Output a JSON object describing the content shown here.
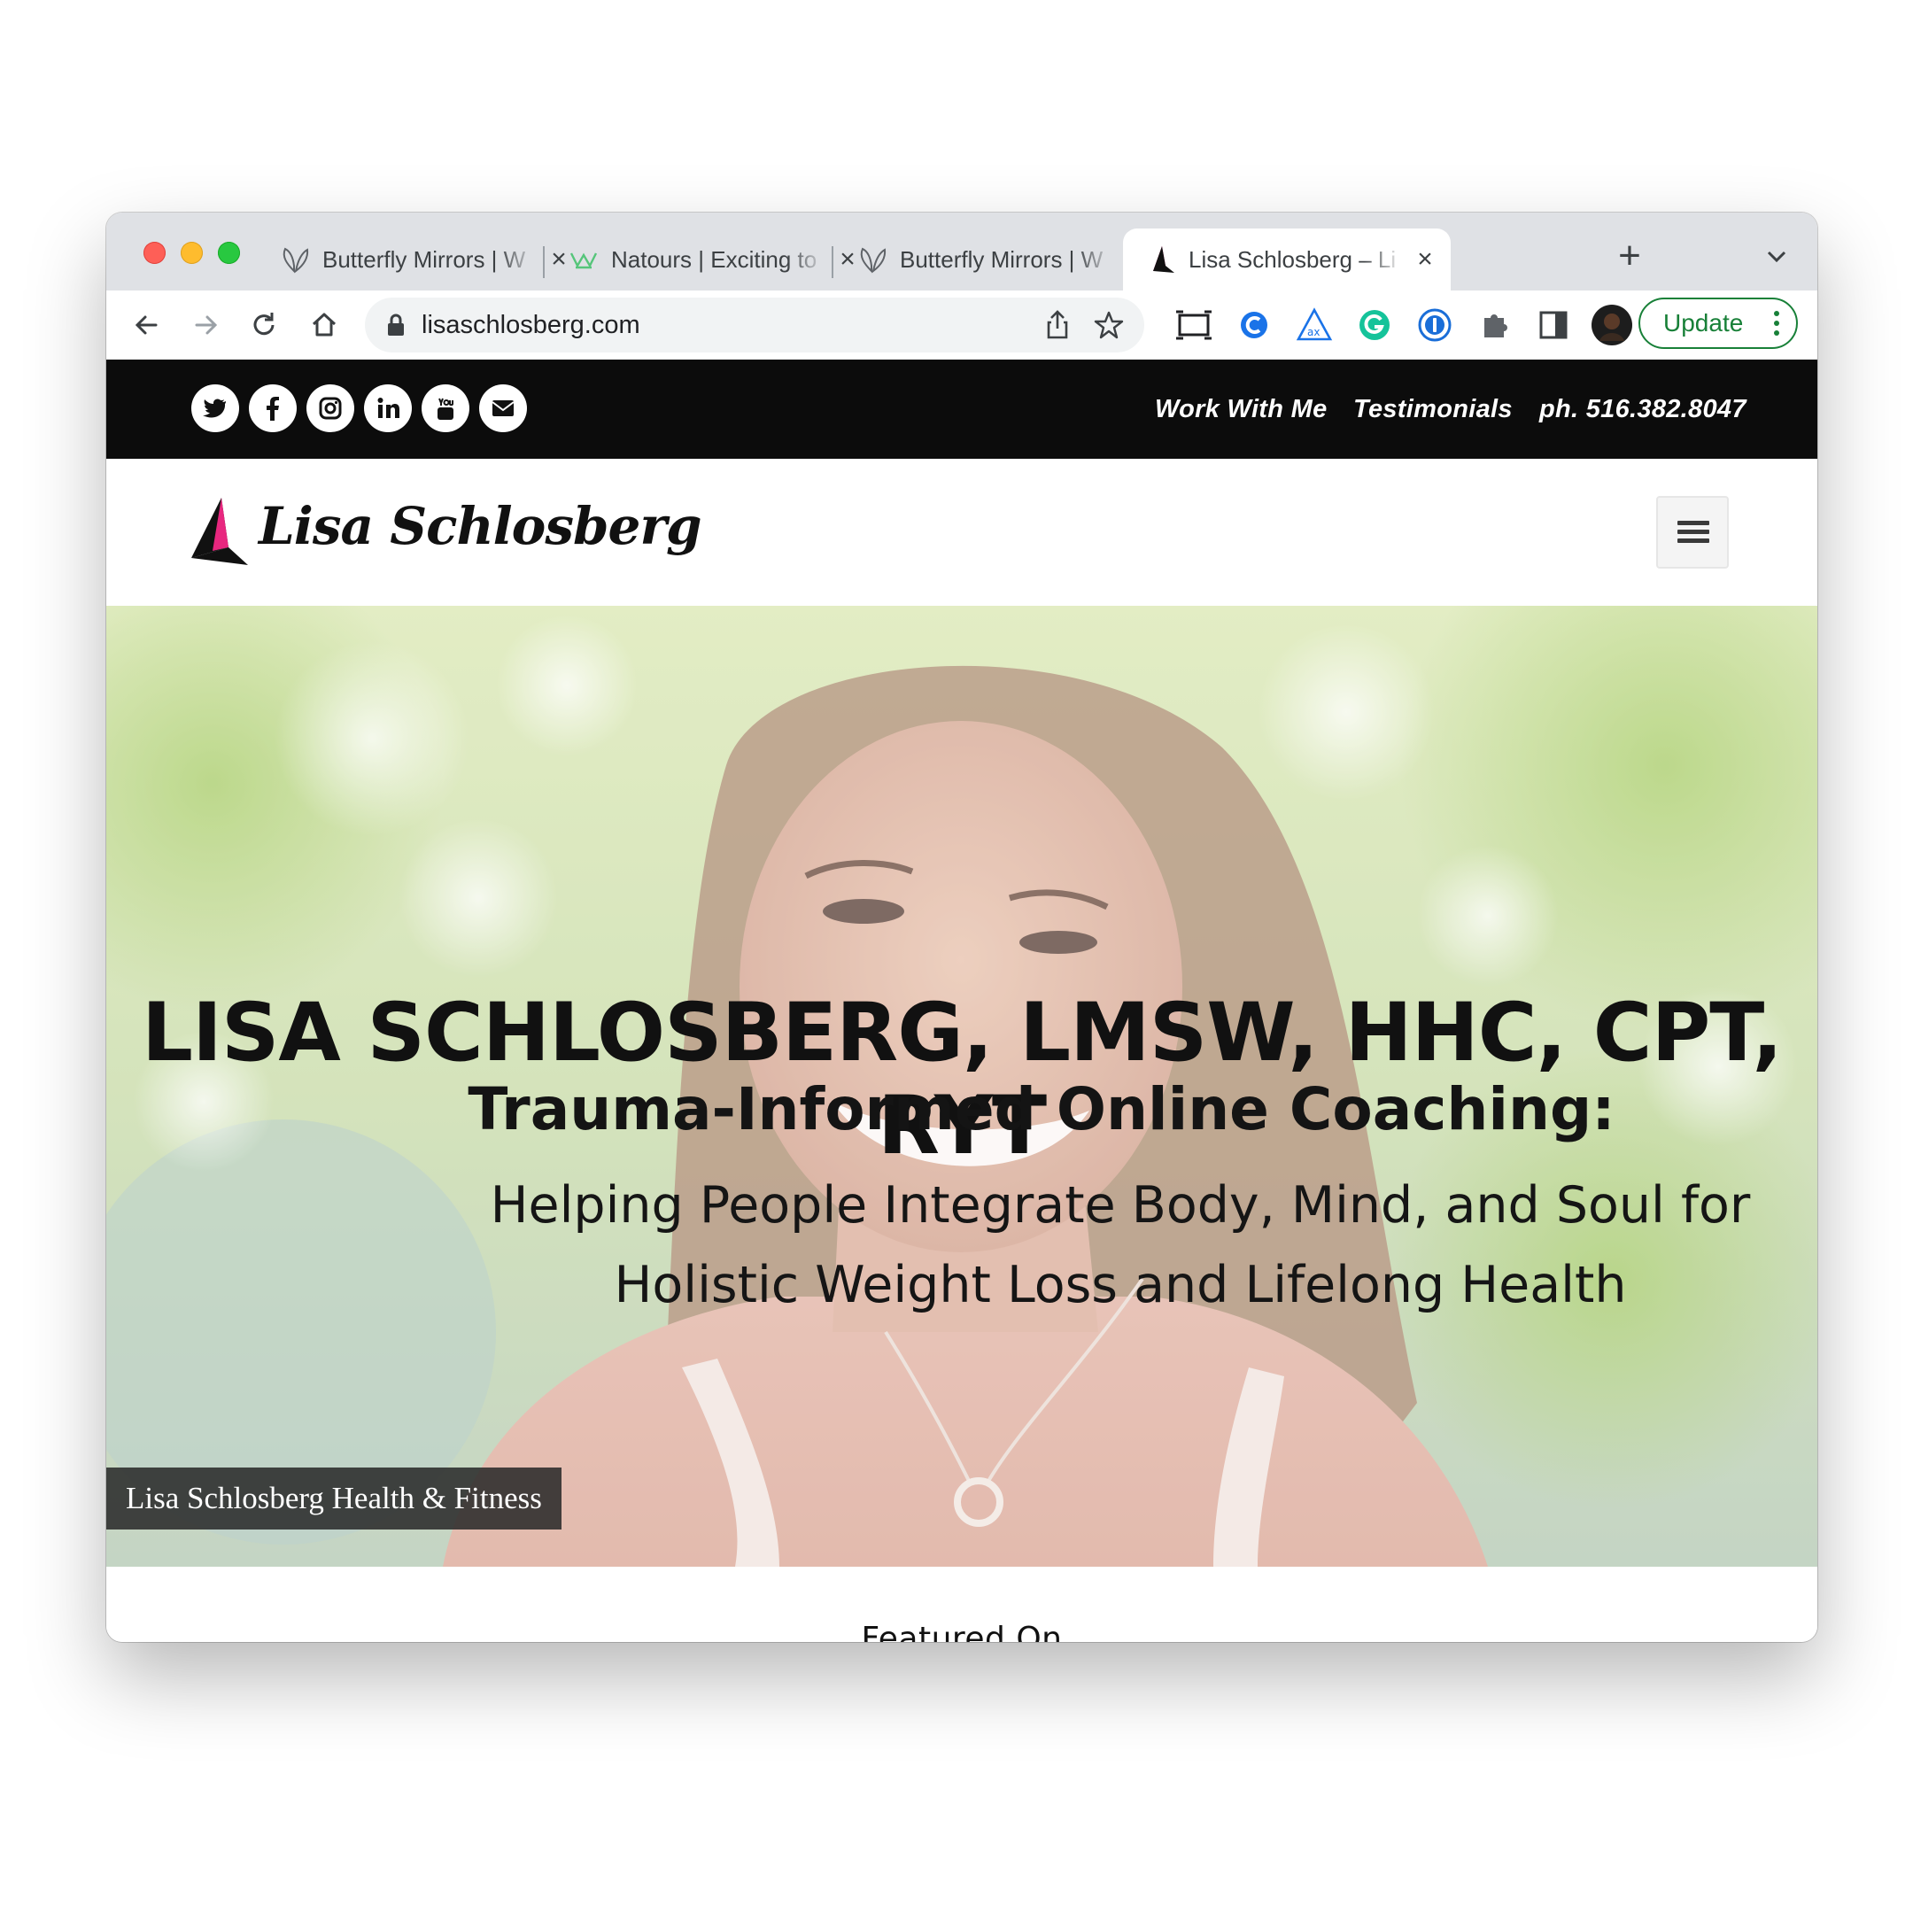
{
  "browser": {
    "tabs": [
      {
        "title": "Butterfly Mirrors | W",
        "favicon": "butterfly-icon",
        "active": false
      },
      {
        "title": "Natours | Exciting to",
        "favicon": "natours-crown-icon",
        "active": false
      },
      {
        "title": "Butterfly Mirrors | W",
        "favicon": "butterfly-icon",
        "active": false
      },
      {
        "title": "Lisa Schlosberg – Li",
        "favicon": "lisa-logo-icon",
        "active": true
      }
    ],
    "close_glyph": "×",
    "new_tab_glyph": "+",
    "url": "lisaschlosberg.com",
    "update_label": "Update",
    "colors": {
      "update_green": "#188038",
      "tabstrip": "#dfe1e5"
    }
  },
  "site": {
    "social_icons": [
      "twitter-icon",
      "facebook-icon",
      "instagram-icon",
      "linkedin-icon",
      "youtube-icon",
      "email-icon"
    ],
    "nav": {
      "work_with_me": "Work With Me",
      "testimonials": "Testimonials",
      "phone": "ph. 516.382.8047"
    },
    "logo_text": "Lisa Schlosberg",
    "logo_colors": {
      "pink": "#e8277f",
      "black": "#111111"
    },
    "hero": {
      "title": "LISA SCHLOSBERG, LMSW, HHC, CPT, RYT",
      "subtitle": "Trauma-Informed Online Coaching:",
      "tagline_line1": "Helping People Integrate Body, Mind, and Soul for",
      "tagline_line2": "Holistic Weight Loss and Lifelong Health",
      "caption": "Lisa Schlosberg Health & Fitness"
    },
    "featured_heading": "Featured On"
  }
}
